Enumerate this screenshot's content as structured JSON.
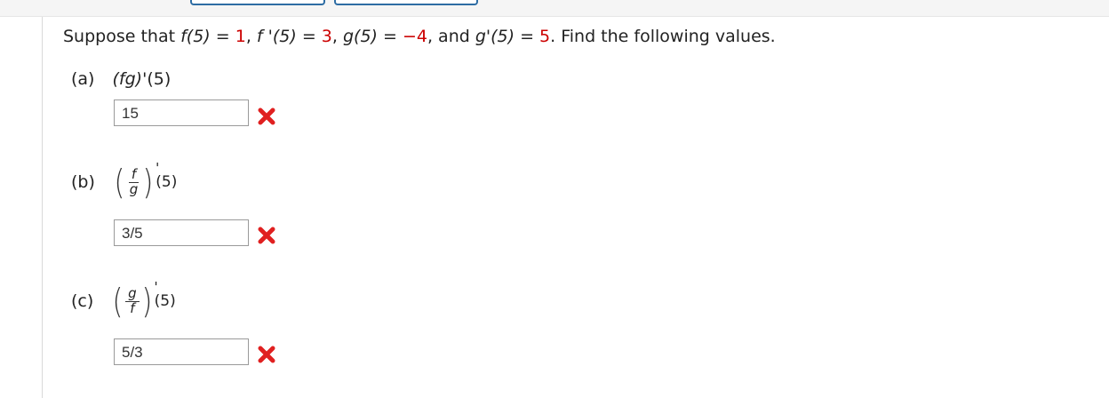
{
  "question": {
    "prefix": "Suppose that ",
    "f5": "f(5)",
    "eq": " = ",
    "f5_val": "1",
    "sep1": ", ",
    "fp5": "f '(5)",
    "fp5_val": "3",
    "sep2": ", ",
    "g5": "g(5)",
    "g5_val": "−4",
    "sep3": ", and ",
    "gp5": "g'(5)",
    "gp5_val": "5",
    "suffix": ". Find the following values."
  },
  "parts": [
    {
      "label": "(a)",
      "expr_fn": "(fg)'",
      "expr_arg": "(5)",
      "answer": "15",
      "status": "incorrect"
    },
    {
      "label": "(b)",
      "num": "f",
      "den": "g",
      "prime": "'",
      "arg": "(5)",
      "answer": "3/5",
      "status": "incorrect"
    },
    {
      "label": "(c)",
      "num": "g",
      "den": "f",
      "prime": "'",
      "arg": "(5)",
      "answer": "5/3",
      "status": "incorrect"
    }
  ],
  "colors": {
    "given_value": "#cc0000",
    "incorrect_mark": "#e02020",
    "top_button_border": "#2e6da4"
  },
  "icons": {
    "incorrect": "x-mark-icon"
  }
}
